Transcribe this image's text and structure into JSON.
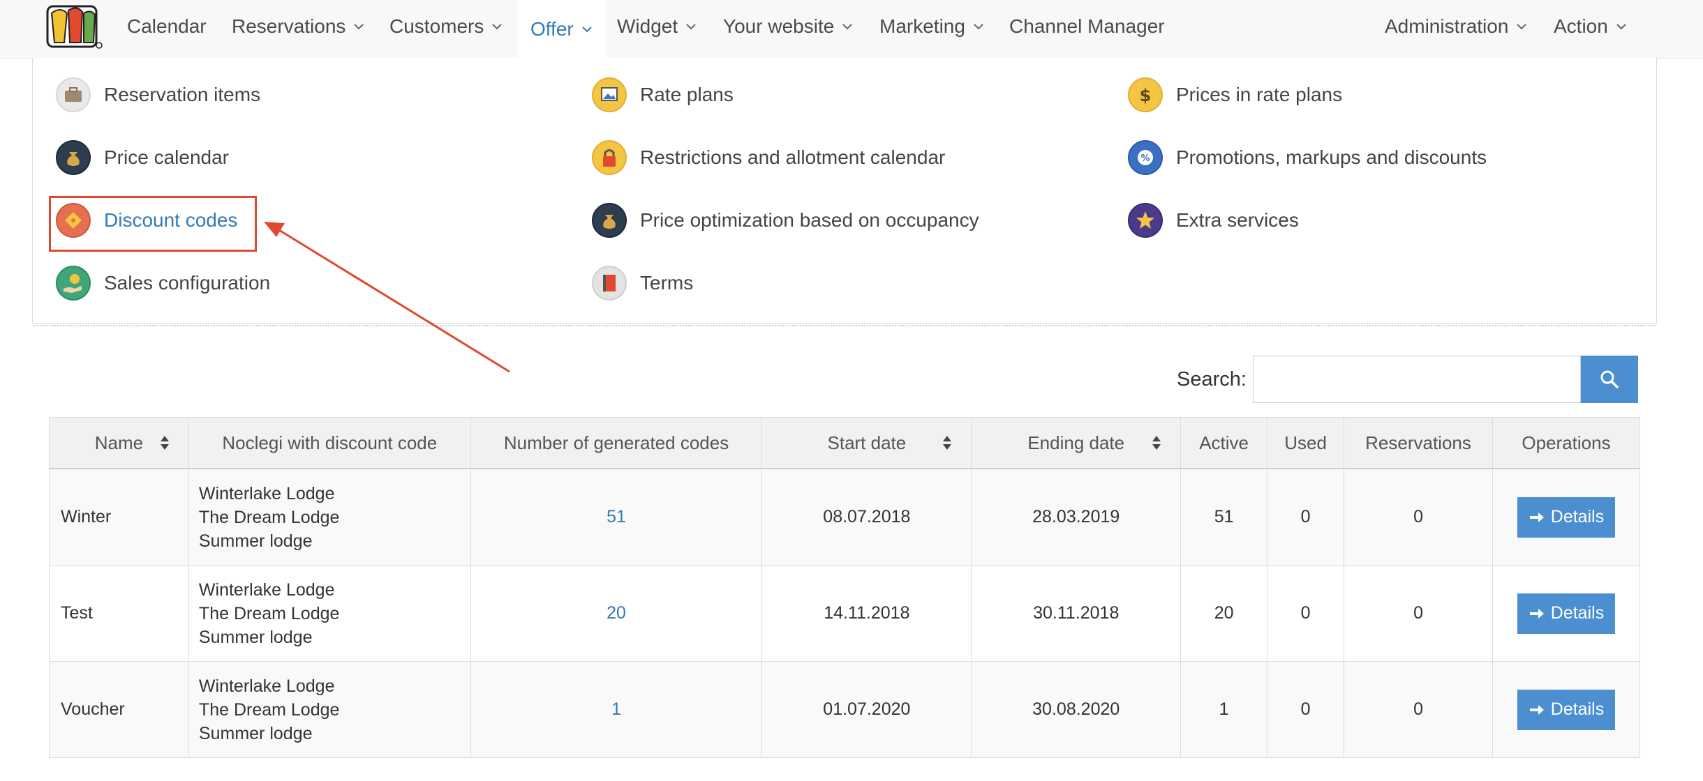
{
  "colors": {
    "accent": "#337ab7",
    "button": "#4b8fd0",
    "highlight": "#e0492f"
  },
  "nav": {
    "items": [
      {
        "label": "Calendar",
        "dropdown": false
      },
      {
        "label": "Reservations",
        "dropdown": true
      },
      {
        "label": "Customers",
        "dropdown": true
      },
      {
        "label": "Offer",
        "dropdown": true,
        "active": true
      },
      {
        "label": "Widget",
        "dropdown": true
      },
      {
        "label": "Your website",
        "dropdown": true
      },
      {
        "label": "Marketing",
        "dropdown": true
      },
      {
        "label": "Channel Manager",
        "dropdown": false
      }
    ],
    "right": [
      {
        "label": "Administration",
        "dropdown": true
      },
      {
        "label": "Action",
        "dropdown": true
      }
    ]
  },
  "offer_menu": {
    "col1": [
      {
        "label": "Reservation items",
        "icon": "briefcase-icon"
      },
      {
        "label": "Price calendar",
        "icon": "money-bag-icon"
      },
      {
        "label": "Discount codes",
        "icon": "discount-tag-icon",
        "current": true
      },
      {
        "label": "Sales configuration",
        "icon": "hand-money-icon"
      }
    ],
    "col2": [
      {
        "label": "Rate plans",
        "icon": "picture-icon"
      },
      {
        "label": "Restrictions and allotment calendar",
        "icon": "lock-icon"
      },
      {
        "label": "Price optimization based on occupancy",
        "icon": "money-bag-icon"
      },
      {
        "label": "Terms",
        "icon": "book-icon"
      }
    ],
    "col3": [
      {
        "label": "Prices in rate plans",
        "icon": "dollar-icon"
      },
      {
        "label": "Promotions, markups and discounts",
        "icon": "percent-badge-icon"
      },
      {
        "label": "Extra services",
        "icon": "star-icon"
      }
    ]
  },
  "search": {
    "label": "Search:",
    "value": "",
    "placeholder": ""
  },
  "table": {
    "headers": [
      "Name",
      "Noclegi with discount code",
      "Number of generated codes",
      "Start date",
      "Ending date",
      "Active",
      "Used",
      "Reservations",
      "Operations"
    ],
    "rows": [
      {
        "name": "Winter",
        "lodges": [
          "Winterlake Lodge",
          "The Dream Lodge",
          "Summer lodge"
        ],
        "generated": "51",
        "start": "08.07.2018",
        "end": "28.03.2019",
        "active": "51",
        "used": "0",
        "reservations": "0",
        "action": "Details"
      },
      {
        "name": "Test",
        "lodges": [
          "Winterlake Lodge",
          "The Dream Lodge",
          "Summer lodge"
        ],
        "generated": "20",
        "start": "14.11.2018",
        "end": "30.11.2018",
        "active": "20",
        "used": "0",
        "reservations": "0",
        "action": "Details"
      },
      {
        "name": "Voucher",
        "lodges": [
          "Winterlake Lodge",
          "The Dream Lodge",
          "Summer lodge"
        ],
        "generated": "1",
        "start": "01.07.2020",
        "end": "30.08.2020",
        "active": "1",
        "used": "0",
        "reservations": "0",
        "action": "Details"
      }
    ]
  }
}
